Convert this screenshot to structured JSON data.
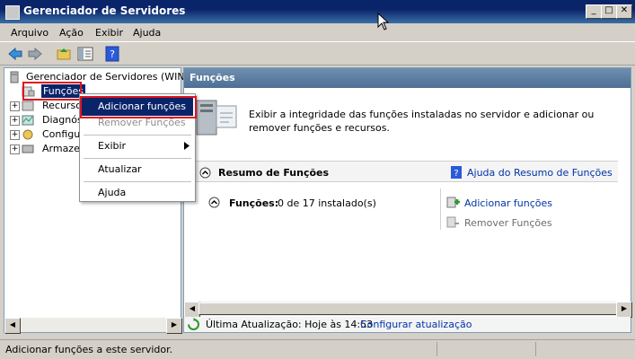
{
  "window": {
    "title": "Gerenciador de Servidores"
  },
  "menubar": {
    "items": [
      "Arquivo",
      "Ação",
      "Exibir",
      "Ajuda"
    ]
  },
  "tree": {
    "root_label": "Gerenciador de Servidores (WIN-4L",
    "items": [
      {
        "label": "Funções"
      },
      {
        "label": "Recursos"
      },
      {
        "label": "Diagnóst"
      },
      {
        "label": "Configur"
      },
      {
        "label": "Armazen"
      }
    ]
  },
  "context_menu": {
    "items": [
      {
        "label": "Adicionar funções",
        "enabled": true
      },
      {
        "label": "Remover Funções",
        "enabled": false
      },
      {
        "label": "Exibir",
        "submenu": true
      },
      {
        "label": "Atualizar"
      },
      {
        "label": "Ajuda"
      }
    ]
  },
  "right": {
    "header": "Funções",
    "description": "Exibir a integridade das funções instaladas no servidor e adicionar ou remover funções e recursos.",
    "summary_title": "Resumo de Funções",
    "summary_help": "Ajuda do Resumo de Funções",
    "roles_label": "Funções:",
    "roles_value": "0 de 17 instalado(s)",
    "action_add": "Adicionar funções",
    "action_remove": "Remover Funções",
    "last_update_label": "Última Atualização: Hoje às 14:53",
    "configure_update": "Configurar atualização"
  },
  "status": {
    "text": "Adicionar funções a este servidor."
  },
  "colors": {
    "highlight": "#0a246a",
    "callout": "#e0141e",
    "link": "#0033aa"
  }
}
